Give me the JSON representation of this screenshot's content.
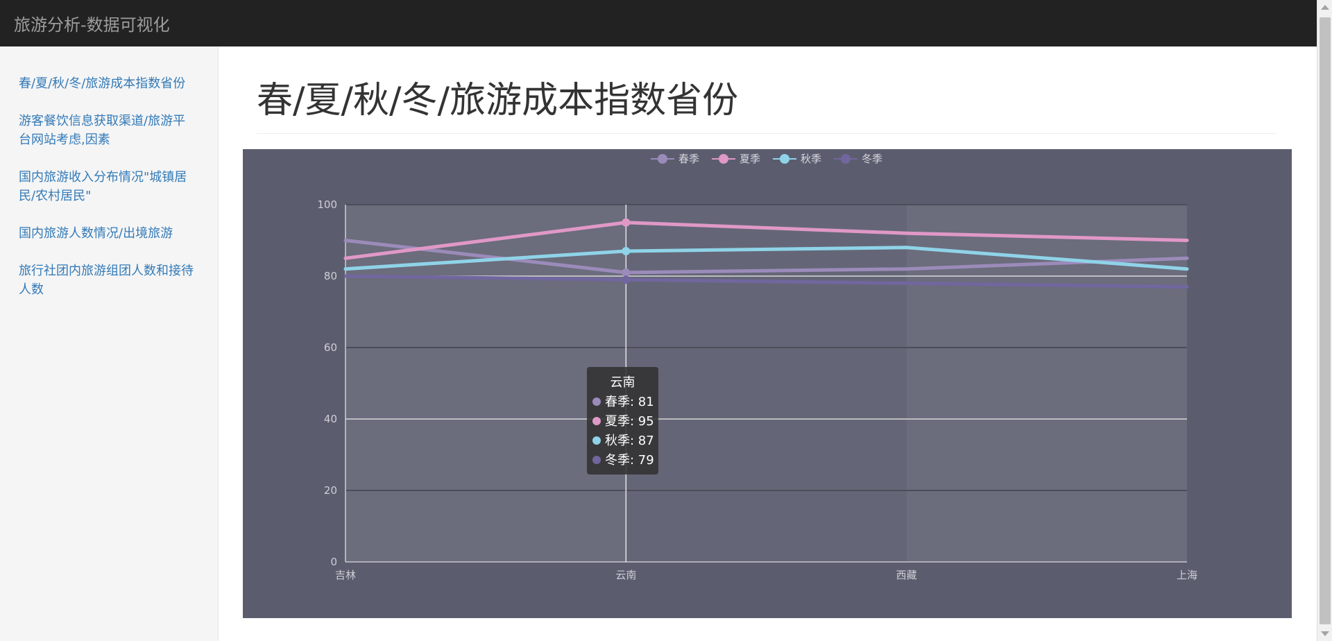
{
  "header": {
    "brand": "旅游分析-数据可视化"
  },
  "sidebar": {
    "items": [
      {
        "label": "春/夏/秋/冬/旅游成本指数省份"
      },
      {
        "label": "游客餐饮信息获取渠道/旅游平台网站考虑,因素"
      },
      {
        "label": "国内旅游收入分布情况\"城镇居民/农村居民\""
      },
      {
        "label": "国内旅游人数情况/出境旅游"
      },
      {
        "label": "旅行社团内旅游组团人数和接待人数"
      }
    ]
  },
  "main": {
    "title": "春/夏/秋/冬/旅游成本指数省份"
  },
  "chart_data": {
    "type": "line",
    "categories": [
      "吉林",
      "云南",
      "西藏",
      "上海"
    ],
    "series": [
      {
        "name": "春季",
        "color": "#9b8bba",
        "values": [
          90,
          81,
          82,
          85
        ]
      },
      {
        "name": "夏季",
        "color": "#e098c7",
        "values": [
          85,
          95,
          92,
          90
        ]
      },
      {
        "name": "秋季",
        "color": "#8fd3e8",
        "values": [
          82,
          87,
          88,
          82
        ]
      },
      {
        "name": "冬季",
        "color": "#71669e",
        "values": [
          80,
          79,
          78,
          77
        ]
      }
    ],
    "ylim": [
      0,
      100
    ],
    "yticks": [
      0,
      20,
      40,
      60,
      80,
      100
    ],
    "legend_position": "top-center",
    "background": "#5b5d6f",
    "tooltip": {
      "category": "云南",
      "rows": [
        "春季: 81",
        "夏季: 95",
        "秋季: 87",
        "冬季: 79"
      ]
    }
  }
}
